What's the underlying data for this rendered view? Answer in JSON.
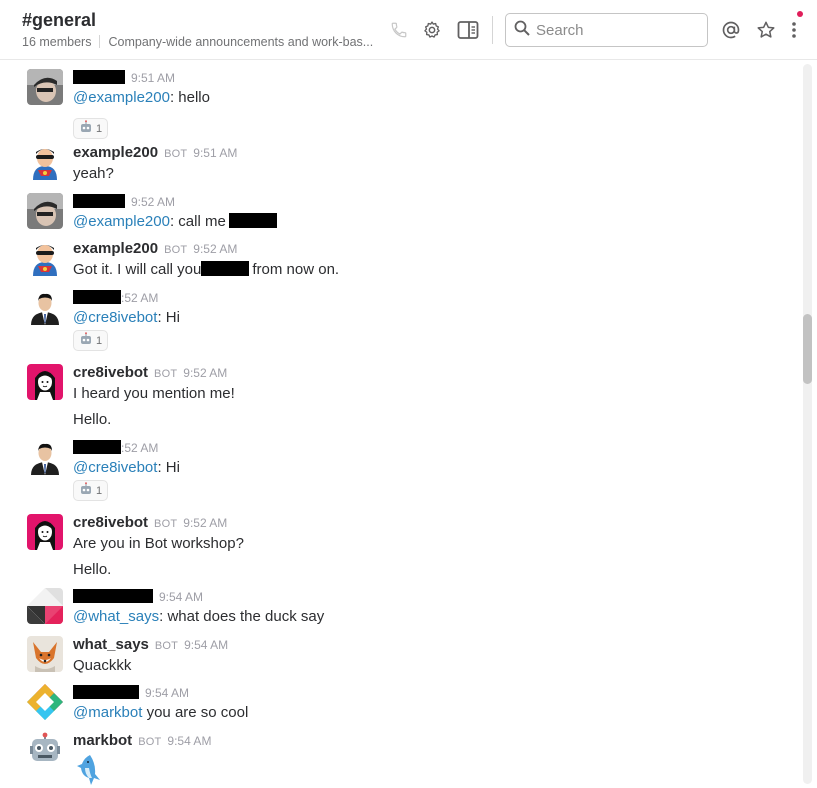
{
  "channel": {
    "name": "#general",
    "members": "16 members",
    "topic": "Company-wide announcements and work-bas..."
  },
  "search": {
    "placeholder": "Search"
  },
  "icons": {
    "call": "phone-icon",
    "settings": "gear-icon",
    "details": "sidebar-panel-icon",
    "mentions": "at-sign-icon",
    "starred": "star-icon",
    "more": "more-vertical-icon",
    "search": "search-icon"
  },
  "colors": {
    "mention": "#2a80b9",
    "notification_dot": "#e01e5a"
  },
  "messages": [
    {
      "author": "",
      "bot": "",
      "time": "9:51 AM",
      "mention": "@example200",
      "text": ": hello",
      "reaction": {
        "emoji": "robot",
        "count": "1"
      }
    },
    {
      "author": "example200",
      "bot": "BOT",
      "time": "9:51 AM",
      "text": "yeah?"
    },
    {
      "author": "",
      "time": "9:52 AM",
      "mention": "@example200",
      "text": ": call me"
    },
    {
      "author": "example200",
      "bot": "BOT",
      "time": "9:52 AM",
      "text_before": "Got it. I will call you",
      "text_after": "from now on."
    },
    {
      "author": "",
      "time": ":52 AM",
      "mention": "@cre8ivebot",
      "text": ": Hi",
      "reaction": {
        "emoji": "robot",
        "count": "1"
      }
    },
    {
      "author": "cre8ivebot",
      "bot": "BOT",
      "time": "9:52 AM",
      "text": "I heard you mention me!",
      "text2": "Hello."
    },
    {
      "author": "",
      "time": ":52 AM",
      "mention": "@cre8ivebot",
      "text": ": Hi",
      "reaction": {
        "emoji": "robot",
        "count": "1"
      }
    },
    {
      "author": "cre8ivebot",
      "bot": "BOT",
      "time": "9:52 AM",
      "text": "Are you in Bot workshop?",
      "text2": "Hello."
    },
    {
      "author": "",
      "time": "9:54 AM",
      "mention": "@what_says",
      "text": ": what does the duck say"
    },
    {
      "author": "what_says",
      "bot": "BOT",
      "time": "9:54 AM",
      "text": "Quackkk"
    },
    {
      "author": "",
      "time": "9:54 AM",
      "mention": "@markbot",
      "text": " you are so cool"
    },
    {
      "author": "markbot",
      "bot": "BOT",
      "time": "9:54 AM",
      "emoji": "shark-icon"
    }
  ]
}
